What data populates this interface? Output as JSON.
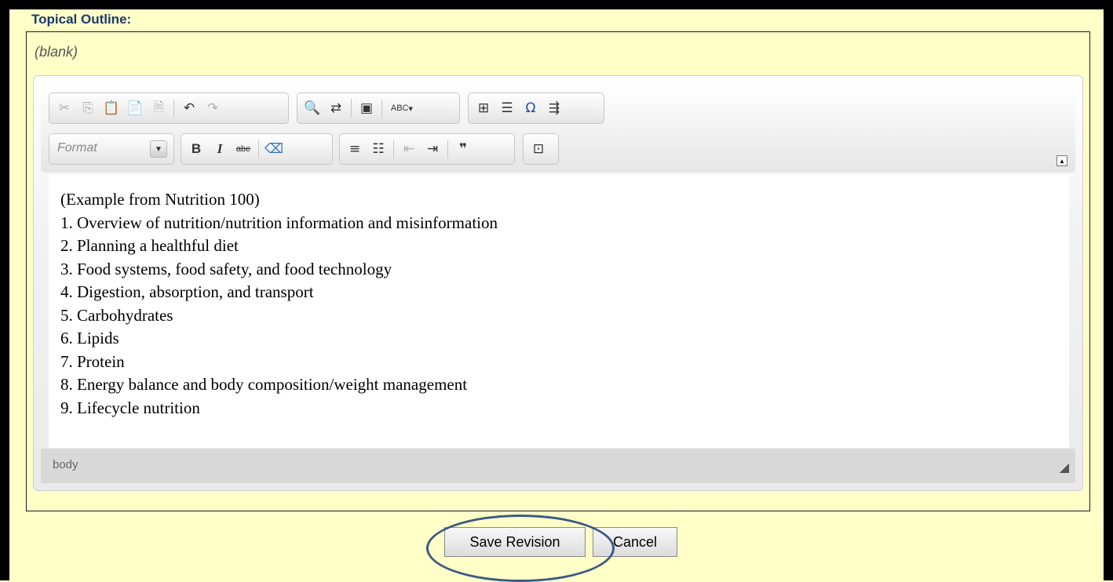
{
  "section": {
    "label": "Topical Outline:",
    "blank_placeholder": "(blank)"
  },
  "toolbar": {
    "row1_group1": [
      "cut-icon",
      "copy-icon",
      "paste-icon",
      "paste-text-icon",
      "paste-word-icon",
      "undo-icon",
      "redo-icon"
    ],
    "row1_group2": [
      "find-icon",
      "replace-icon",
      "select-all-icon",
      "spellcheck-icon"
    ],
    "row1_group3": [
      "table-icon",
      "horizontal-line-icon",
      "special-char-icon",
      "page-break-icon"
    ],
    "format_label": "Format",
    "row2_group1": [
      "bold-icon",
      "italic-icon",
      "strike-icon",
      "remove-format-icon"
    ],
    "row2_group2": [
      "numbered-list-icon",
      "bulleted-list-icon",
      "outdent-icon",
      "indent-icon",
      "blockquote-icon"
    ],
    "row2_group3": [
      "maximize-icon"
    ],
    "bold_glyph": "B",
    "italic_glyph": "I",
    "strike_glyph": "abe",
    "special_char_glyph": "Ω",
    "spell_glyph": "ABC"
  },
  "content": {
    "lines": [
      "(Example from Nutrition 100)",
      "1. Overview of nutrition/nutrition information and misinformation",
      "2. Planning a healthful diet",
      "3. Food systems, food safety, and food technology",
      "4. Digestion, absorption, and transport",
      "5. Carbohydrates",
      "6. Lipids",
      "7. Protein",
      "8. Energy balance and body composition/weight management",
      "9. Lifecycle nutrition"
    ]
  },
  "status_bar": {
    "path": "body"
  },
  "actions": {
    "save_label": "Save Revision",
    "cancel_label": "Cancel"
  }
}
